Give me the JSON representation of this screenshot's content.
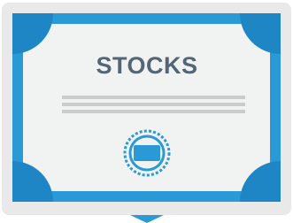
{
  "certificate": {
    "title": "STOCKS",
    "icon": "stock-certificate-icon",
    "seal_icon": "seal-badge-icon",
    "colors": {
      "frame_outer": "#e9e9e9",
      "frame_border": "#2a9ad6",
      "corner": "#1f86c6",
      "paper": "#f1f2f2",
      "title_text": "#546575",
      "lines": "#cbcbcb",
      "seal": "#2a9ad6"
    }
  }
}
